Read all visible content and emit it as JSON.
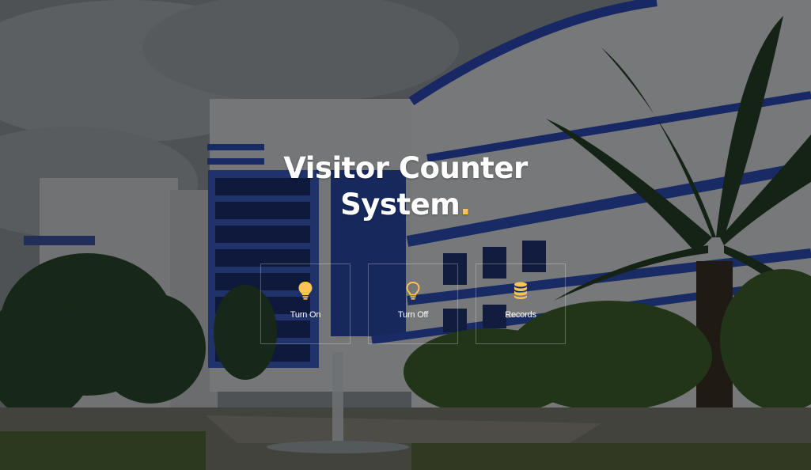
{
  "hero": {
    "title_line1": "Visitor Counter",
    "title_line2": "System",
    "title_dot": "."
  },
  "actions": [
    {
      "label": "Turn On",
      "icon": "lightbulb-on-icon"
    },
    {
      "label": "Turn Off",
      "icon": "lightbulb-off-icon"
    },
    {
      "label": "Records",
      "icon": "database-icon"
    }
  ],
  "colors": {
    "accent": "#ffc451",
    "overlay": "rgba(0,0,0,0.45)",
    "text": "#ffffff"
  }
}
